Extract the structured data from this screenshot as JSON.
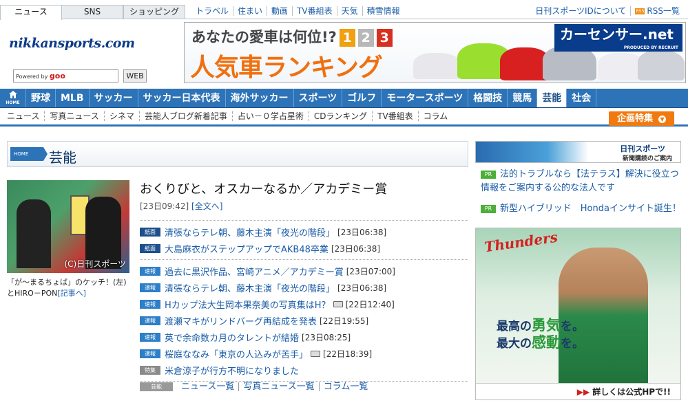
{
  "tabs": {
    "news": "ニュース",
    "sns": "SNS",
    "shopping": "ショッピング"
  },
  "top_links": [
    "トラベル",
    "住まい",
    "動画",
    "TV番組表",
    "天気",
    "積雪情報"
  ],
  "top_right": {
    "id_link": "日刊スポーツIDについて",
    "rss": "RSS一覧",
    "rss_badge": "RSS"
  },
  "logo": "nikkansports.com",
  "search": {
    "powered": "Powered by",
    "engine": "goo",
    "button": "WEB"
  },
  "banner": {
    "headline": "あなたの愛車は何位!?",
    "ranks": [
      "1",
      "2",
      "3"
    ],
    "main": "人気車ランキング",
    "brand": "カーセンサー.net",
    "brand_sub": "PRODUCED BY RECRUIT"
  },
  "main_nav": [
    {
      "label": "HOME",
      "name": "nav-home"
    },
    {
      "label": "野球",
      "name": "nav-baseball"
    },
    {
      "label": "MLB",
      "name": "nav-mlb"
    },
    {
      "label": "サッカー",
      "name": "nav-soccer"
    },
    {
      "label": "サッカー日本代表",
      "name": "nav-soccer-japan"
    },
    {
      "label": "海外サッカー",
      "name": "nav-world-soccer"
    },
    {
      "label": "スポーツ",
      "name": "nav-sports"
    },
    {
      "label": "ゴルフ",
      "name": "nav-golf"
    },
    {
      "label": "モータースポーツ",
      "name": "nav-motorsports"
    },
    {
      "label": "格闘技",
      "name": "nav-fighting"
    },
    {
      "label": "競馬",
      "name": "nav-keiba"
    },
    {
      "label": "芸能",
      "name": "nav-geino"
    },
    {
      "label": "社会",
      "name": "nav-society"
    }
  ],
  "sub_nav": [
    "ニュース",
    "写真ニュース",
    "シネマ",
    "芸能人ブログ新着記事",
    "占い－０学占星術",
    "CDランキング",
    "TV番組表",
    "コラム"
  ],
  "kikaku": "企画特集",
  "section": {
    "home_badge": "HOME",
    "title": "芸能"
  },
  "photo": {
    "credit": "(C)日刊スポーツ",
    "caption": "「が～まるちょば」のケッチ！(左)とHIRO－PON",
    "caption_link": "[記事へ]"
  },
  "top_story": {
    "headline": "おくりびと、オスカーなるか／アカデミー賞",
    "time": "[23日09:42]",
    "link": "[全文へ]"
  },
  "news_groups": [
    [
      {
        "badge": "紙面",
        "type": "shimen",
        "title": "清張ならテレ朝、藤木主演「夜光の階段」",
        "time": "[23日06:38]",
        "photo": false
      },
      {
        "badge": "紙面",
        "type": "shimen",
        "title": "大島麻衣がステップアップでAKB48卒業",
        "time": "[23日06:38]",
        "photo": false
      }
    ],
    [
      {
        "badge": "速報",
        "type": "sokuho",
        "title": "過去に黒沢作品、宮崎アニメ／アカデミー賞",
        "time": "[23日07:00]",
        "photo": false
      },
      {
        "badge": "速報",
        "type": "sokuho",
        "title": "清張ならテレ朝、藤木主演「夜光の階段」",
        "time": "[23日06:38]",
        "photo": false
      },
      {
        "badge": "速報",
        "type": "sokuho",
        "title": "Hカップ法大生岡本果奈美の写真集はH？",
        "time": "[22日12:40]",
        "photo": true
      },
      {
        "badge": "速報",
        "type": "sokuho",
        "title": "渡瀬マキがリンドバーグ再結成を発表",
        "time": "[22日19:55]",
        "photo": false
      },
      {
        "badge": "速報",
        "type": "sokuho",
        "title": "英で余命数カ月のタレントが結婚",
        "time": "[23日08:25]",
        "photo": false
      },
      {
        "badge": "速報",
        "type": "sokuho",
        "title": "桜庭ななみ「東京の人込みが苦手」",
        "time": "[22日18:39]",
        "photo": true
      },
      {
        "badge": "特集",
        "type": "tokushu",
        "title": "米倉涼子が行方不明になりました",
        "time": "",
        "photo": false
      }
    ]
  ],
  "news_footer": {
    "badge": "芸能",
    "links": [
      "ニュース一覧",
      "写真ニュース一覧",
      "コラム一覧"
    ]
  },
  "right_banner": {
    "title": "日刊スポーツ",
    "sub": "新聞購読のご案内"
  },
  "pr": [
    {
      "badge": "PR",
      "text": "法的トラブルなら【法テラス】解決に役立つ情報をご案内する公的な法人です"
    },
    {
      "badge": "PR",
      "text": "新型ハイブリッド　Hondaインサイト誕生！"
    }
  ],
  "ad": {
    "team": "Thunders",
    "copy1a": "最高の",
    "copy1b": "勇気",
    "copy1c": "を。",
    "copy2a": "最大の",
    "copy2b": "感動",
    "copy2c": "を。",
    "more": "詳しくは公式HPで!!",
    "more_arrow": "▶▶"
  },
  "colors": {
    "nav_blue": "#2d73b8",
    "accent_orange": "#f07a10",
    "link_blue": "#1a5ca8",
    "pr_green": "#4caf3a"
  },
  "icons": [
    "home-icon",
    "rss-icon",
    "camera-icon",
    "chevron-down-icon"
  ]
}
